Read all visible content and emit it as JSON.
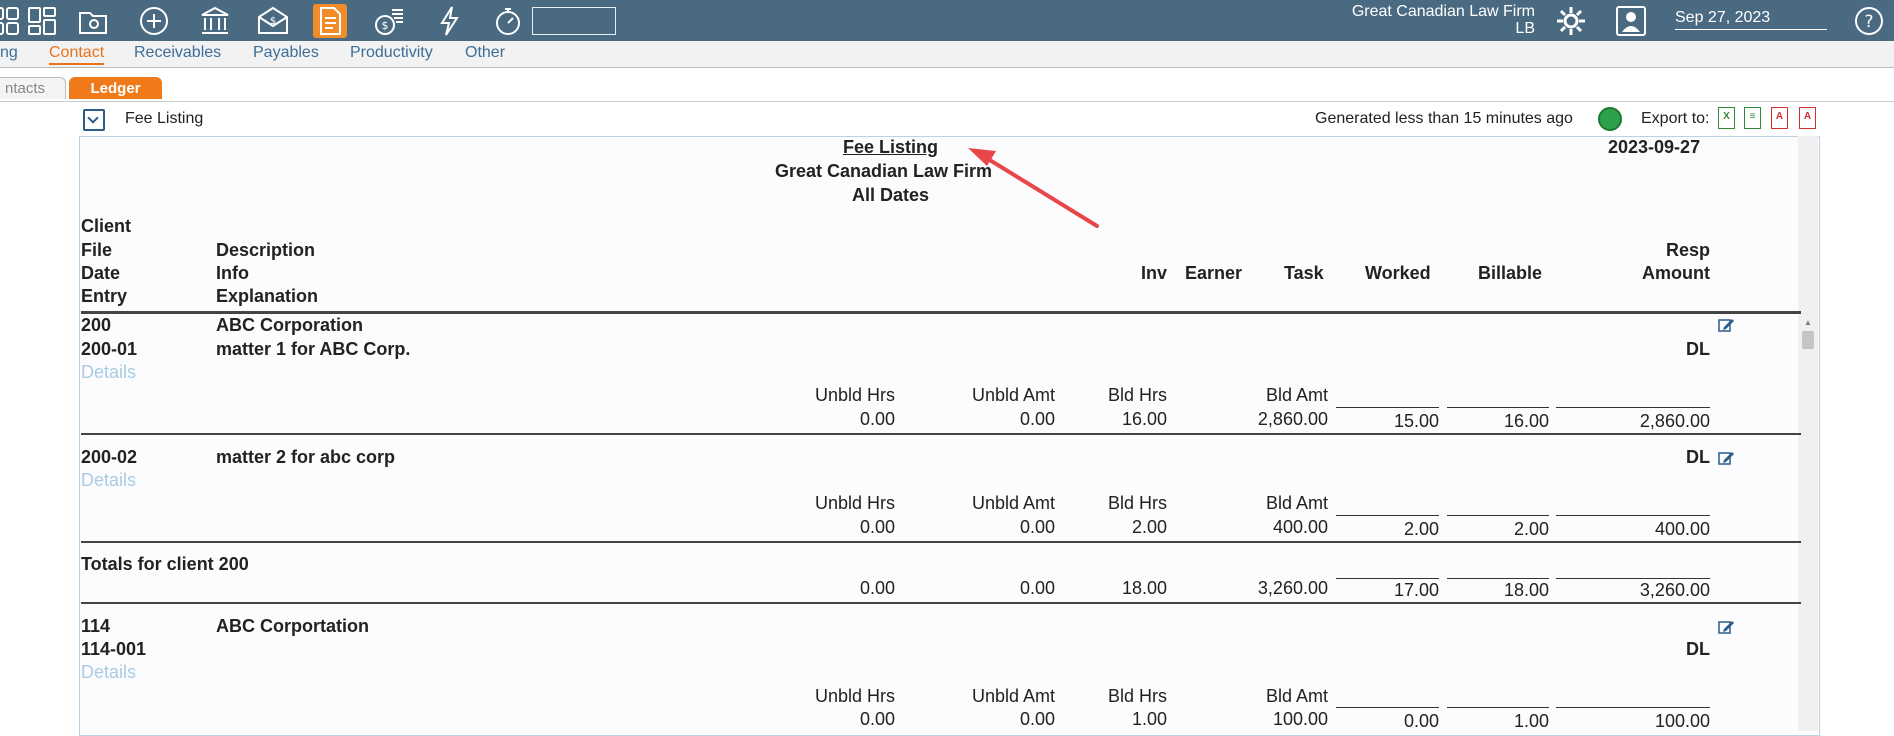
{
  "topbar": {
    "icons": [
      "dashboard-icon",
      "folder-icon",
      "add-icon",
      "bank-icon",
      "mail-money-icon",
      "document-icon",
      "coins-icon",
      "lightning-icon",
      "timer-icon"
    ],
    "search_value": "",
    "firm": "Great Canadian Law Firm",
    "user_initials": "LB",
    "date": "Sep 27, 2023",
    "help": "?"
  },
  "menu": {
    "items": [
      "ng",
      "Contact",
      "Receivables",
      "Payables",
      "Productivity",
      "Other"
    ]
  },
  "tabs": [
    "ntacts",
    "Ledger"
  ],
  "report_bar": {
    "title": "Fee Listing",
    "generated": "Generated less than 15 minutes ago",
    "export_label": "Export to:",
    "export_formats": [
      "xls",
      "csv",
      "pdf",
      "pdf-print"
    ]
  },
  "report": {
    "title": "Fee Listing",
    "firm": "Great Canadian Law Firm",
    "dates": "All Dates",
    "report_date": "2023-09-27",
    "headers": {
      "col1": [
        "Client",
        "File",
        "Date",
        "Entry"
      ],
      "col2": [
        "Description",
        "Info",
        "Explanation"
      ],
      "inv": "Inv",
      "earner": "Earner",
      "task": "Task",
      "worked": "Worked",
      "billable": "Billable",
      "resp": "Resp",
      "amount": "Amount"
    },
    "sub_labels": {
      "unbld_hrs": "Unbld Hrs",
      "unbld_amt": "Unbld Amt",
      "bld_hrs": "Bld Hrs",
      "bld_amt": "Bld Amt"
    },
    "details_label": "Details",
    "clients": [
      {
        "number": "200",
        "name": "ABC Corporation",
        "files": [
          {
            "file": "200-01",
            "description": "matter 1 for ABC Corp.",
            "resp": "DL",
            "unbld_hrs": "0.00",
            "unbld_amt": "0.00",
            "bld_hrs": "16.00",
            "bld_amt": "2,860.00",
            "worked": "15.00",
            "billable": "16.00",
            "amount": "2,860.00"
          },
          {
            "file": "200-02",
            "description": "matter 2 for abc corp",
            "resp": "DL",
            "unbld_hrs": "0.00",
            "unbld_amt": "0.00",
            "bld_hrs": "2.00",
            "bld_amt": "400.00",
            "worked": "2.00",
            "billable": "2.00",
            "amount": "400.00"
          }
        ],
        "totals": {
          "label": "Totals for client 200",
          "unbld_hrs": "0.00",
          "unbld_amt": "0.00",
          "bld_hrs": "18.00",
          "bld_amt": "3,260.00",
          "worked": "17.00",
          "billable": "18.00",
          "amount": "3,260.00"
        }
      },
      {
        "number": "114",
        "name": "ABC Corportation",
        "files": [
          {
            "file": "114-001",
            "description": "",
            "resp": "DL",
            "unbld_hrs": "0.00",
            "unbld_amt": "0.00",
            "bld_hrs": "1.00",
            "bld_amt": "100.00",
            "worked": "0.00",
            "billable": "1.00",
            "amount": "100.00"
          }
        ]
      }
    ]
  },
  "colors": {
    "topbar": "#4a6a82",
    "accent": "#f07a1a",
    "annotation_arrow": "#e8474a"
  }
}
